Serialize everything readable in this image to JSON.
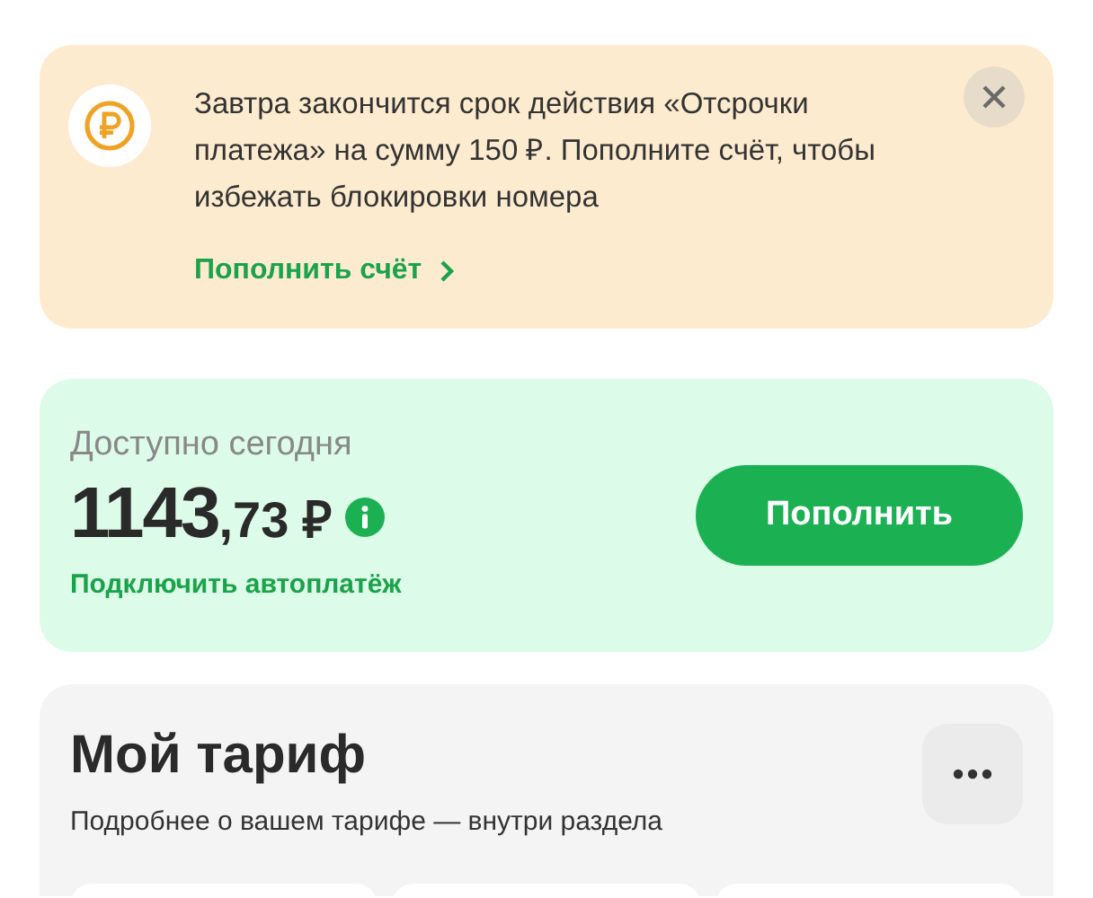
{
  "notice": {
    "text": "Завтра закончится срок действия «Отсрочки платежа» на сумму 150 ₽. Пополните счёт, чтобы избежать блокировки номера",
    "link": "Пополнить счёт"
  },
  "balance": {
    "label": "Доступно сегодня",
    "integer": "1143",
    "fraction": ",73 ₽",
    "autopay_link": "Подключить автоплатёж",
    "button": "Пополнить"
  },
  "tariff": {
    "title": "Мой тариф",
    "subtitle": "Подробнее о вашем тарифе — внутри раздела",
    "cards": [
      {
        "kind": "card"
      },
      {
        "kind": "card"
      },
      {
        "kind": "card"
      }
    ]
  }
}
